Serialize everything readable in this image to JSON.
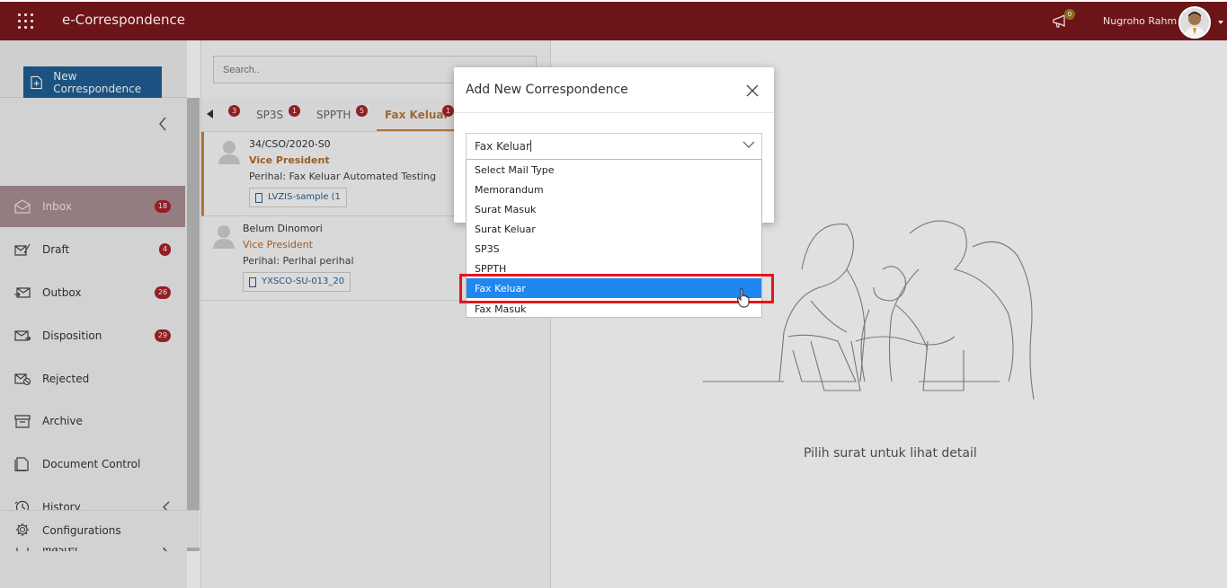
{
  "header": {
    "app_title": "e-Correspondence",
    "notification_count": "0",
    "user_name": "Nugroho Rahm",
    "brand_color": "#6b1519"
  },
  "sidebar": {
    "new_button_label": "New Correspondence",
    "items": [
      {
        "label": "Inbox",
        "badge": "18",
        "icon": "inbox-icon"
      },
      {
        "label": "Draft",
        "badge": "4",
        "icon": "draft-icon"
      },
      {
        "label": "Outbox",
        "badge": "26",
        "icon": "outbox-icon"
      },
      {
        "label": "Disposition",
        "badge": "29",
        "icon": "disposition-icon"
      },
      {
        "label": "Rejected",
        "badge": "",
        "icon": "rejected-icon"
      },
      {
        "label": "Archive",
        "badge": "",
        "icon": "archive-icon"
      },
      {
        "label": "Document Control",
        "badge": "",
        "icon": "document-control-icon"
      },
      {
        "label": "History",
        "badge": "",
        "icon": "history-icon"
      },
      {
        "label": "Master",
        "badge": "",
        "icon": "master-icon"
      }
    ],
    "configurations_label": "Configurations"
  },
  "list": {
    "search_placeholder": "Search..",
    "tabs": [
      {
        "label": "SP3S",
        "badge": "1"
      },
      {
        "label": "SPPTH",
        "badge": "5"
      },
      {
        "label": "Fax Keluar",
        "badge": "1"
      }
    ],
    "prev_badge": "3",
    "cards": [
      {
        "ref": "34/CSO/2020-S0",
        "role": "Vice President",
        "perihal": "Perihal: Fax Keluar Automated Testing",
        "file": "LVZIS-sample (1"
      },
      {
        "ref": "Belum Dinomori",
        "role": "Vice President",
        "perihal": "Perihal: Perihal perihal",
        "file": "YXSCO-SU-013_20"
      }
    ]
  },
  "detail": {
    "empty_message": "Pilih surat untuk lihat detail"
  },
  "modal": {
    "title": "Add New Correspondence",
    "selected_value": "Fax Keluar",
    "options": [
      "Select Mail Type",
      "Memorandum",
      "Surat Masuk",
      "Surat Keluar",
      "SP3S",
      "SPPTH",
      "Fax Keluar",
      "Fax Masuk"
    ],
    "highlighted_option": "Fax Keluar",
    "highlight_color": "#1e88f0"
  }
}
